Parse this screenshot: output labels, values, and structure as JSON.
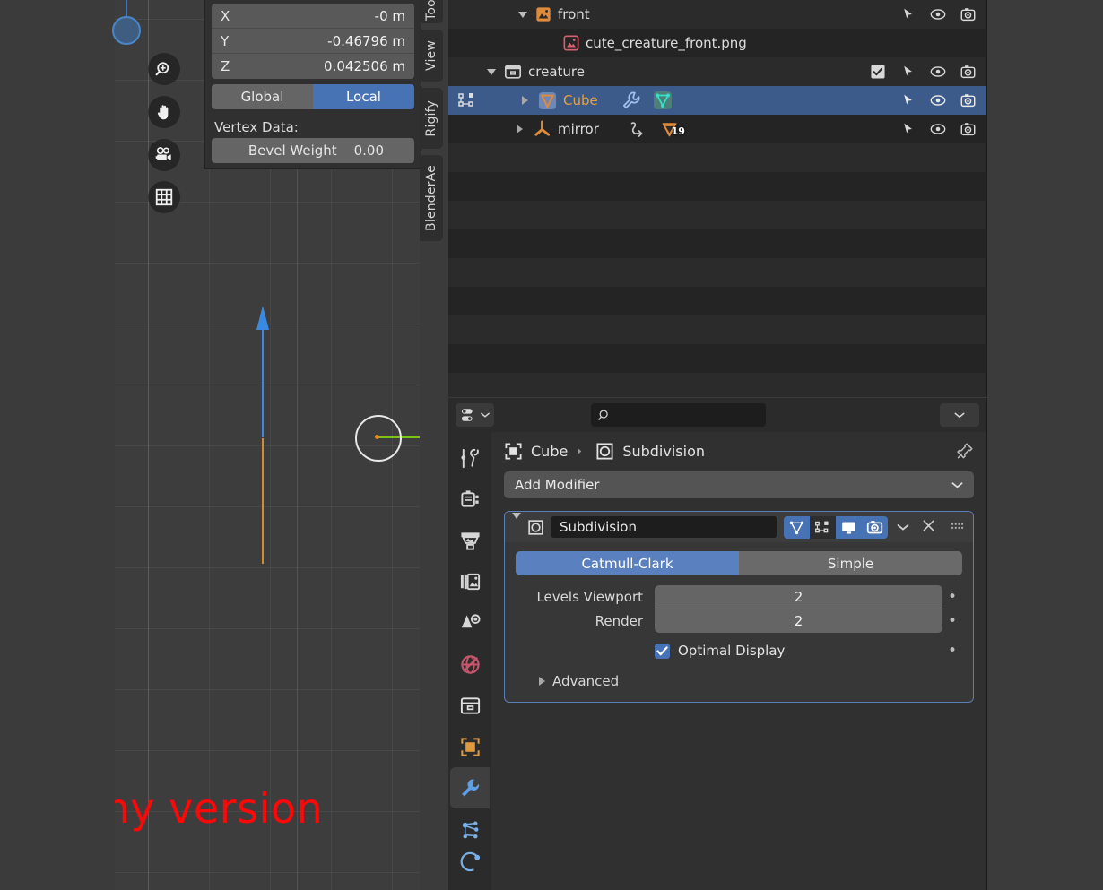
{
  "viewport": {
    "annotation": "my version",
    "annotation_color": "#fb0808",
    "tools": [
      {
        "name": "zoom-icon",
        "title": "Zoom"
      },
      {
        "name": "hand-icon",
        "title": "Move View"
      },
      {
        "name": "camera-icon",
        "title": "Camera View"
      },
      {
        "name": "grid-icon",
        "title": "Toggle Orthographic"
      }
    ],
    "nav_gizmo": {
      "x_color": "#e04c5a",
      "y_color": "#9fc93c",
      "z_color": "#3d78c0"
    },
    "gizmo": {
      "z_color": "#3b8ae2",
      "y_color": "#7ac418",
      "neg_color": "#d18b31",
      "vertex_color": "#b03a44"
    }
  },
  "sidebar": {
    "transform": [
      {
        "axis": "X",
        "value": "-0 m"
      },
      {
        "axis": "Y",
        "value": "-0.46796 m"
      },
      {
        "axis": "Z",
        "value": "0.042506 m"
      }
    ],
    "orientation": {
      "global": "Global",
      "local": "Local",
      "active": "Local"
    },
    "vertex_data_label": "Vertex Data:",
    "bevel_weight": {
      "label": "Bevel Weight",
      "value": "0.00"
    },
    "tabs": [
      "Tool",
      "View",
      "Rigify",
      "BlenderAe"
    ]
  },
  "outliner": {
    "rows": [
      {
        "name": "front",
        "indent": 2,
        "disclosure": "down",
        "icon": "image-icon",
        "icon_color": "#e08b3a",
        "selected": false,
        "checkbox": false,
        "filters": true
      },
      {
        "name": "cute_creature_front.png",
        "indent": 3,
        "disclosure": "none",
        "icon": "image-data-icon",
        "icon_color": "#d4616f",
        "selected": false,
        "checkbox": false,
        "filters": false
      },
      {
        "name": "creature",
        "indent": 1,
        "disclosure": "down",
        "icon": "collection-icon",
        "icon_color": "#d0d0d0",
        "selected": false,
        "checkbox": true,
        "filters": true
      },
      {
        "name": "Cube",
        "indent": 2,
        "disclosure": "right",
        "icon": "mesh-object-icon",
        "icon_color": "#e08b3a",
        "selected": true,
        "checkbox": false,
        "filters": true,
        "badges": [
          "wrench-icon",
          "mesh-data-icon"
        ]
      },
      {
        "name": "mirror",
        "indent": 2,
        "disclosure": "right",
        "icon": "empty-axes-icon",
        "icon_color": "#e08b3a",
        "selected": false,
        "checkbox": false,
        "filters": true,
        "badges": [
          "relation-icon",
          "mesh-object-icon"
        ],
        "badge_count": "19"
      }
    ],
    "filter_icons": [
      "cursor-select-icon",
      "eye-icon",
      "camera-render-icon"
    ]
  },
  "properties": {
    "editor_type": "properties-editor-icon",
    "search_placeholder": "",
    "search_value": "",
    "breadcrumb": [
      {
        "label": "Cube",
        "icon": "object-icon"
      },
      {
        "label": "Subdivision",
        "icon": "modifier-icon"
      }
    ],
    "pin_icon": "pin-icon",
    "add_modifier": "Add Modifier",
    "tabs": [
      {
        "name": "tool",
        "icon": "tool-icon",
        "active": false
      },
      {
        "name": "render",
        "icon": "render-icon",
        "active": false
      },
      {
        "name": "output",
        "icon": "output-printer-icon",
        "active": false
      },
      {
        "name": "view-layer",
        "icon": "view-layer-images-icon",
        "active": false
      },
      {
        "name": "scene",
        "icon": "scene-cone-icon",
        "active": false
      },
      {
        "name": "world",
        "icon": "world-globe-icon",
        "active": false
      },
      {
        "name": "collection",
        "icon": "collection-box-icon",
        "active": false
      },
      {
        "name": "object",
        "icon": "object-square-icon",
        "active": false
      },
      {
        "name": "modifier",
        "icon": "wrench-icon",
        "active": true
      },
      {
        "name": "particles",
        "icon": "particles-icon",
        "active": false
      }
    ],
    "modifier": {
      "name": "Subdivision",
      "expanded": true,
      "toggles": [
        {
          "name": "on-cage",
          "icon": "mesh-data-icon",
          "on": true
        },
        {
          "name": "edit-mode",
          "icon": "edit-mode-icon",
          "on": false
        },
        {
          "name": "realtime",
          "icon": "display-monitor-icon",
          "on": true
        },
        {
          "name": "render",
          "icon": "camera-icon",
          "on": true
        }
      ],
      "extras_icon": "chevron-down-icon",
      "close_icon": "x-icon",
      "drag_icon": "drag-dots-icon",
      "algorithm": {
        "options": [
          "Catmull-Clark",
          "Simple"
        ],
        "active": "Catmull-Clark"
      },
      "levels": [
        {
          "label": "Levels Viewport",
          "value": "2"
        },
        {
          "label": "Render",
          "value": "2"
        }
      ],
      "optimal_display": {
        "label": "Optimal Display",
        "checked": true
      },
      "advanced_label": "Advanced"
    }
  }
}
